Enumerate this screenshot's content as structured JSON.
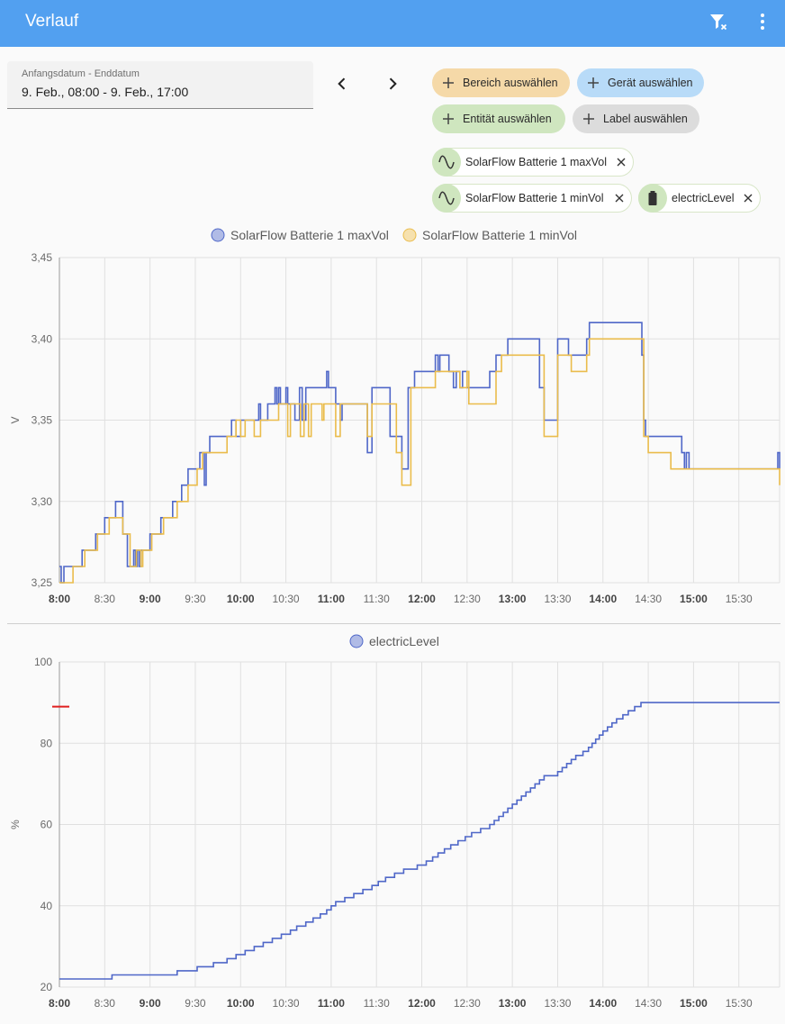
{
  "header": {
    "title": "Verlauf",
    "filter_icon": "filter-remove-icon",
    "menu_icon": "dots-vertical-icon"
  },
  "date_picker": {
    "label": "Anfangsdatum - Enddatum",
    "value": "9. Feb., 08:00 - 9. Feb., 17:00"
  },
  "target_chips": {
    "area": "Bereich auswählen",
    "device": "Gerät auswählen",
    "entity": "Entität auswählen",
    "label": "Label auswählen"
  },
  "selected": [
    {
      "label": "SolarFlow Batterie 1 maxVol",
      "icon": "sine-wave-icon"
    },
    {
      "label": "SolarFlow Batterie 1 minVol",
      "icon": "sine-wave-icon"
    },
    {
      "label": "electricLevel",
      "icon": "battery-icon"
    }
  ],
  "colors": {
    "header": "#52a0f0",
    "max": "#4f67c8",
    "min": "#eabc4b",
    "level": "#4f67c8",
    "marker": "#e02020"
  },
  "chart_data": [
    {
      "type": "line",
      "step": true,
      "ylabel": "V",
      "ylim": [
        3.25,
        3.45
      ],
      "yticks": [
        "3,25",
        "3,30",
        "3,35",
        "3,40",
        "3,45"
      ],
      "ytick_values": [
        3.25,
        3.3,
        3.35,
        3.4,
        3.45
      ],
      "xlim": [
        8.0,
        15.95
      ],
      "xticks": [
        {
          "t": 8.0,
          "label": "8:00",
          "bold": true
        },
        {
          "t": 8.5,
          "label": "8:30",
          "bold": false
        },
        {
          "t": 9.0,
          "label": "9:00",
          "bold": true
        },
        {
          "t": 9.5,
          "label": "9:30",
          "bold": false
        },
        {
          "t": 10.0,
          "label": "10:00",
          "bold": true
        },
        {
          "t": 10.5,
          "label": "10:30",
          "bold": false
        },
        {
          "t": 11.0,
          "label": "11:00",
          "bold": true
        },
        {
          "t": 11.5,
          "label": "11:30",
          "bold": false
        },
        {
          "t": 12.0,
          "label": "12:00",
          "bold": true
        },
        {
          "t": 12.5,
          "label": "12:30",
          "bold": false
        },
        {
          "t": 13.0,
          "label": "13:00",
          "bold": true
        },
        {
          "t": 13.5,
          "label": "13:30",
          "bold": false
        },
        {
          "t": 14.0,
          "label": "14:00",
          "bold": true
        },
        {
          "t": 14.5,
          "label": "14:30",
          "bold": false
        },
        {
          "t": 15.0,
          "label": "15:00",
          "bold": true
        },
        {
          "t": 15.5,
          "label": "15:30",
          "bold": false
        }
      ],
      "legend": [
        "SolarFlow Batterie 1 maxVol",
        "SolarFlow Batterie 1 minVol"
      ],
      "series": [
        {
          "name": "SolarFlow Batterie 1 maxVol",
          "color": "#4f67c8",
          "points": [
            [
              8.0,
              3.26
            ],
            [
              8.02,
              3.25
            ],
            [
              8.05,
              3.26
            ],
            [
              8.25,
              3.27
            ],
            [
              8.4,
              3.28
            ],
            [
              8.5,
              3.29
            ],
            [
              8.62,
              3.3
            ],
            [
              8.7,
              3.28
            ],
            [
              8.75,
              3.26
            ],
            [
              8.82,
              3.27
            ],
            [
              8.84,
              3.26
            ],
            [
              8.86,
              3.27
            ],
            [
              8.88,
              3.26
            ],
            [
              8.9,
              3.27
            ],
            [
              9.0,
              3.28
            ],
            [
              9.12,
              3.29
            ],
            [
              9.25,
              3.3
            ],
            [
              9.35,
              3.31
            ],
            [
              9.42,
              3.32
            ],
            [
              9.5,
              3.32
            ],
            [
              9.55,
              3.33
            ],
            [
              9.6,
              3.31
            ],
            [
              9.62,
              3.33
            ],
            [
              9.66,
              3.34
            ],
            [
              9.85,
              3.34
            ],
            [
              9.9,
              3.35
            ],
            [
              9.95,
              3.34
            ],
            [
              10.0,
              3.35
            ],
            [
              10.1,
              3.35
            ],
            [
              10.2,
              3.36
            ],
            [
              10.22,
              3.35
            ],
            [
              10.3,
              3.36
            ],
            [
              10.38,
              3.37
            ],
            [
              10.4,
              3.36
            ],
            [
              10.42,
              3.37
            ],
            [
              10.44,
              3.36
            ],
            [
              10.5,
              3.37
            ],
            [
              10.52,
              3.36
            ],
            [
              10.6,
              3.35
            ],
            [
              10.65,
              3.37
            ],
            [
              10.68,
              3.35
            ],
            [
              10.72,
              3.37
            ],
            [
              10.95,
              3.38
            ],
            [
              10.97,
              3.37
            ],
            [
              11.05,
              3.36
            ],
            [
              11.1,
              3.35
            ],
            [
              11.12,
              3.36
            ],
            [
              11.3,
              3.36
            ],
            [
              11.4,
              3.33
            ],
            [
              11.45,
              3.37
            ],
            [
              11.5,
              3.37
            ],
            [
              11.65,
              3.34
            ],
            [
              11.7,
              3.34
            ],
            [
              11.78,
              3.32
            ],
            [
              11.85,
              3.37
            ],
            [
              11.88,
              3.37
            ],
            [
              11.92,
              3.38
            ],
            [
              12.1,
              3.38
            ],
            [
              12.15,
              3.39
            ],
            [
              12.18,
              3.38
            ],
            [
              12.2,
              3.39
            ],
            [
              12.28,
              3.39
            ],
            [
              12.3,
              3.38
            ],
            [
              12.35,
              3.37
            ],
            [
              12.38,
              3.38
            ],
            [
              12.42,
              3.37
            ],
            [
              12.45,
              3.38
            ],
            [
              12.5,
              3.37
            ],
            [
              12.75,
              3.38
            ],
            [
              12.82,
              3.39
            ],
            [
              12.9,
              3.39
            ],
            [
              12.95,
              3.4
            ],
            [
              13.3,
              3.37
            ],
            [
              13.35,
              3.35
            ],
            [
              13.5,
              3.4
            ],
            [
              13.62,
              3.39
            ],
            [
              13.82,
              3.4
            ],
            [
              13.85,
              3.41
            ],
            [
              14.4,
              3.41
            ],
            [
              14.43,
              3.39
            ],
            [
              14.45,
              3.35
            ],
            [
              14.47,
              3.34
            ],
            [
              14.85,
              3.34
            ],
            [
              14.87,
              3.33
            ],
            [
              14.9,
              3.32
            ],
            [
              14.92,
              3.33
            ],
            [
              14.95,
              3.32
            ],
            [
              15.92,
              3.32
            ],
            [
              15.93,
              3.33
            ],
            [
              15.95,
              3.32
            ]
          ]
        },
        {
          "name": "SolarFlow Batterie 1 minVol",
          "color": "#eabc4b",
          "points": [
            [
              8.0,
              3.25
            ],
            [
              8.15,
              3.26
            ],
            [
              8.28,
              3.27
            ],
            [
              8.42,
              3.28
            ],
            [
              8.55,
              3.29
            ],
            [
              8.7,
              3.28
            ],
            [
              8.78,
              3.26
            ],
            [
              8.85,
              3.27
            ],
            [
              8.9,
              3.26
            ],
            [
              8.92,
              3.27
            ],
            [
              9.02,
              3.28
            ],
            [
              9.15,
              3.29
            ],
            [
              9.3,
              3.3
            ],
            [
              9.42,
              3.31
            ],
            [
              9.52,
              3.32
            ],
            [
              9.58,
              3.33
            ],
            [
              9.62,
              3.33
            ],
            [
              9.7,
              3.33
            ],
            [
              9.85,
              3.34
            ],
            [
              9.95,
              3.35
            ],
            [
              10.0,
              3.34
            ],
            [
              10.05,
              3.35
            ],
            [
              10.15,
              3.34
            ],
            [
              10.22,
              3.35
            ],
            [
              10.42,
              3.36
            ],
            [
              10.52,
              3.34
            ],
            [
              10.55,
              3.36
            ],
            [
              10.62,
              3.36
            ],
            [
              10.66,
              3.34
            ],
            [
              10.7,
              3.36
            ],
            [
              10.75,
              3.34
            ],
            [
              10.78,
              3.36
            ],
            [
              10.9,
              3.35
            ],
            [
              10.92,
              3.36
            ],
            [
              11.05,
              3.34
            ],
            [
              11.1,
              3.36
            ],
            [
              11.4,
              3.34
            ],
            [
              11.45,
              3.36
            ],
            [
              11.72,
              3.33
            ],
            [
              11.78,
              3.31
            ],
            [
              11.88,
              3.37
            ],
            [
              12.15,
              3.38
            ],
            [
              12.35,
              3.38
            ],
            [
              12.42,
              3.37
            ],
            [
              12.5,
              3.38
            ],
            [
              12.52,
              3.36
            ],
            [
              12.82,
              3.38
            ],
            [
              12.88,
              3.39
            ],
            [
              13.35,
              3.34
            ],
            [
              13.5,
              3.39
            ],
            [
              13.65,
              3.38
            ],
            [
              13.82,
              3.39
            ],
            [
              13.85,
              3.4
            ],
            [
              14.4,
              3.4
            ],
            [
              14.45,
              3.34
            ],
            [
              14.5,
              3.33
            ],
            [
              14.75,
              3.32
            ],
            [
              15.92,
              3.32
            ],
            [
              15.95,
              3.31
            ]
          ]
        }
      ]
    },
    {
      "type": "line",
      "step": true,
      "ylabel": "%",
      "ylim": [
        20,
        100
      ],
      "yticks": [
        "20",
        "40",
        "60",
        "80",
        "100"
      ],
      "ytick_values": [
        20,
        40,
        60,
        80,
        100
      ],
      "xlim": [
        8.0,
        15.95
      ],
      "legend": [
        "electricLevel"
      ],
      "marker_level": 89,
      "series": [
        {
          "name": "electricLevel",
          "color": "#4f67c8",
          "points": [
            [
              8.0,
              22
            ],
            [
              8.58,
              23
            ],
            [
              9.3,
              24
            ],
            [
              9.52,
              25
            ],
            [
              9.7,
              26
            ],
            [
              9.85,
              27
            ],
            [
              9.95,
              28
            ],
            [
              10.05,
              29
            ],
            [
              10.12,
              29
            ],
            [
              10.15,
              30
            ],
            [
              10.25,
              31
            ],
            [
              10.35,
              32
            ],
            [
              10.45,
              33
            ],
            [
              10.55,
              34
            ],
            [
              10.62,
              35
            ],
            [
              10.72,
              36
            ],
            [
              10.8,
              37
            ],
            [
              10.88,
              38
            ],
            [
              10.95,
              39
            ],
            [
              11.0,
              40
            ],
            [
              11.05,
              41
            ],
            [
              11.15,
              42
            ],
            [
              11.25,
              43
            ],
            [
              11.35,
              44
            ],
            [
              11.45,
              45
            ],
            [
              11.52,
              46
            ],
            [
              11.6,
              47
            ],
            [
              11.7,
              48
            ],
            [
              11.8,
              49
            ],
            [
              11.95,
              50
            ],
            [
              12.05,
              51
            ],
            [
              12.12,
              52
            ],
            [
              12.18,
              53
            ],
            [
              12.25,
              54
            ],
            [
              12.32,
              55
            ],
            [
              12.4,
              56
            ],
            [
              12.48,
              57
            ],
            [
              12.55,
              58
            ],
            [
              12.65,
              59
            ],
            [
              12.75,
              60
            ],
            [
              12.8,
              61
            ],
            [
              12.85,
              62
            ],
            [
              12.9,
              63
            ],
            [
              12.95,
              64
            ],
            [
              13.0,
              65
            ],
            [
              13.05,
              66
            ],
            [
              13.1,
              67
            ],
            [
              13.15,
              68
            ],
            [
              13.2,
              69
            ],
            [
              13.25,
              70
            ],
            [
              13.3,
              71
            ],
            [
              13.35,
              72
            ],
            [
              13.5,
              73
            ],
            [
              13.55,
              74
            ],
            [
              13.6,
              75
            ],
            [
              13.65,
              76
            ],
            [
              13.7,
              77
            ],
            [
              13.78,
              78
            ],
            [
              13.84,
              79
            ],
            [
              13.88,
              80
            ],
            [
              13.92,
              81
            ],
            [
              13.96,
              82
            ],
            [
              14.0,
              83
            ],
            [
              14.05,
              84
            ],
            [
              14.1,
              85
            ],
            [
              14.15,
              86
            ],
            [
              14.22,
              87
            ],
            [
              14.28,
              88
            ],
            [
              14.35,
              89
            ],
            [
              14.42,
              90
            ],
            [
              15.95,
              90
            ]
          ]
        }
      ]
    }
  ]
}
